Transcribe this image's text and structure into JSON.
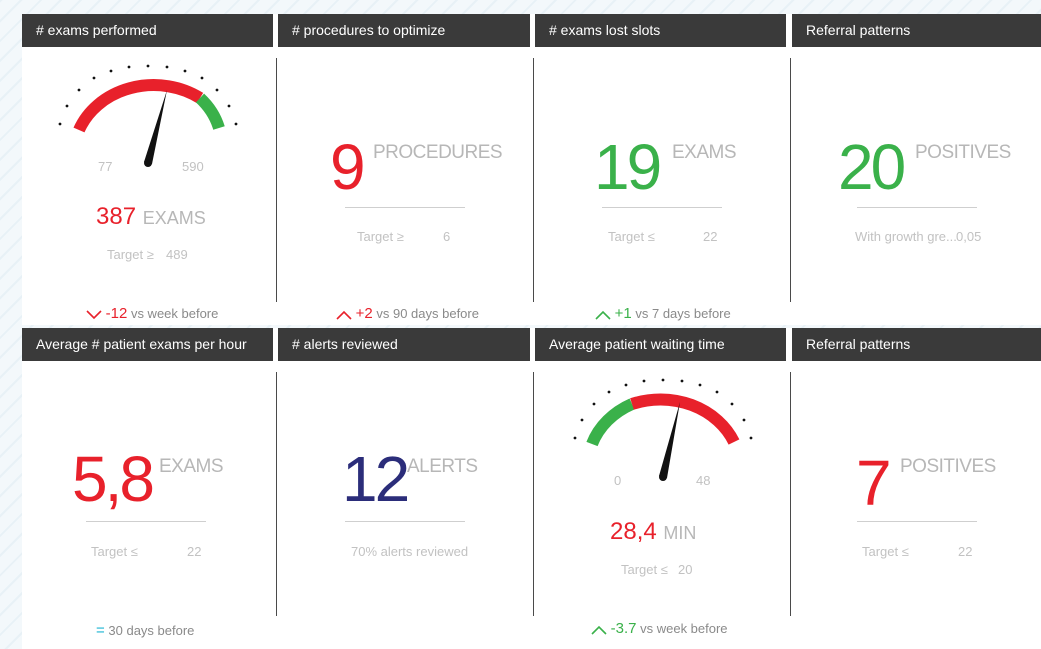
{
  "tiles": [
    {
      "title": "# exams performed",
      "gauge": {
        "min_label": "77",
        "max_label": "590"
      },
      "value": "387",
      "unit": "EXAMS",
      "target_label": "Target ≥",
      "target_value": "489",
      "trend": {
        "direction": "down",
        "delta": "-12",
        "label": "vs week before"
      }
    },
    {
      "title": "# procedures to optimize",
      "value": "9",
      "unit": "PROCEDURES",
      "target_label": "Target ≥",
      "target_value": "6",
      "trend": {
        "direction": "up",
        "delta": "+2",
        "label": "vs 90 days before"
      }
    },
    {
      "title": "# exams lost slots",
      "value": "19",
      "unit": "EXAMS",
      "target_label": "Target ≤",
      "target_value": "22",
      "trend": {
        "direction": "up",
        "delta": "+1",
        "label": "vs 7 days before"
      }
    },
    {
      "title": "Referral patterns",
      "value": "20",
      "unit": "POSITIVES",
      "target_label": "With growth gre...",
      "target_value": "0,05"
    },
    {
      "title": "Average # patient exams per hour",
      "value": "5,8",
      "unit": "EXAMS",
      "target_label": "Target ≤",
      "target_value": "22",
      "trend": {
        "direction": "equal",
        "delta": "=",
        "label": "30 days before"
      }
    },
    {
      "title": "# alerts reviewed",
      "value": "12",
      "unit": "ALERTS",
      "target_label": "70% alerts reviewed"
    },
    {
      "title": "Average patient waiting time",
      "gauge": {
        "min_label": "0",
        "max_label": "48"
      },
      "value": "28,4",
      "unit": "MIN",
      "target_label": "Target ≤",
      "target_value": "20",
      "trend": {
        "direction": "up",
        "delta": "-3.7",
        "label": "vs week before"
      }
    },
    {
      "title": "Referral patterns",
      "value": "7",
      "unit": "POSITIVES",
      "target_label": "Target ≤",
      "target_value": "22"
    }
  ],
  "colors": {
    "red": "#e8212b",
    "green": "#3ab14a",
    "navy": "#2b2d7a",
    "cyan": "#1eb6d3",
    "header_bg": "#3a3a3a"
  },
  "icons": {
    "trend_down": "chevron-down-icon",
    "trend_up": "chevron-up-icon",
    "trend_equal": "equals-icon"
  }
}
